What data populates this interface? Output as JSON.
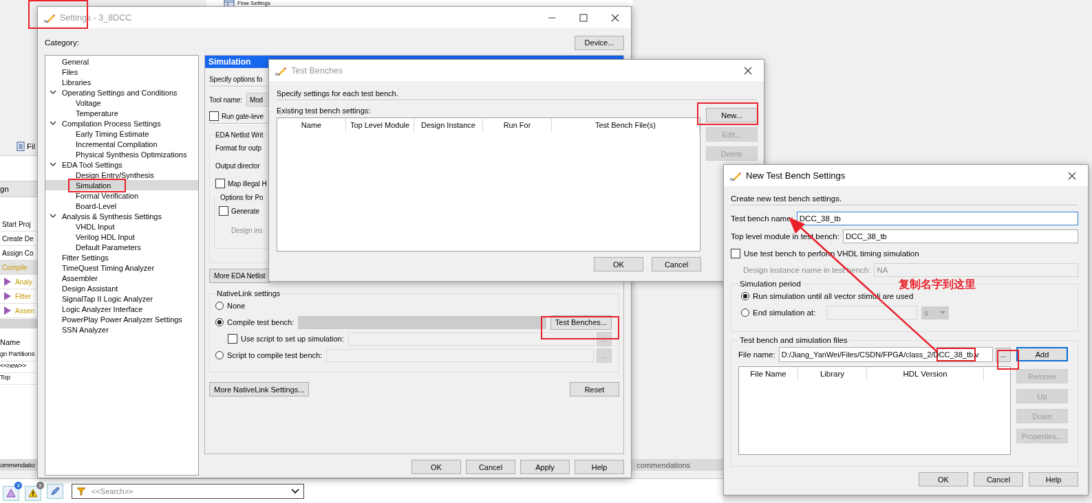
{
  "background_app": {
    "top_strip": "Flow Settings",
    "tab": "Fil",
    "header": "gn",
    "tasks": [
      {
        "label": "Start Proj",
        "kind": "task",
        "selected": false
      },
      {
        "label": "Create De",
        "kind": "task",
        "selected": false
      },
      {
        "label": "Assign Co",
        "kind": "task",
        "selected": false
      },
      {
        "label": "Compile",
        "kind": "task",
        "selected": true
      },
      {
        "label": "Analy",
        "kind": "step",
        "selected": false
      },
      {
        "label": "Fitter",
        "kind": "step",
        "selected": false
      },
      {
        "label": "Assen",
        "kind": "step",
        "selected": false
      }
    ],
    "hierarchy_header": "Name",
    "hierarchy_rows": [
      "gn Partitions",
      "<<new>>",
      "Top"
    ],
    "message_tabs": [
      "ommendatio",
      "commendations"
    ],
    "badges": [
      "3",
      "5"
    ],
    "search": {
      "placeholder": "<<Search>>"
    }
  },
  "settings": {
    "title": "Settings - 3_8DCC",
    "category_label": "Category:",
    "device_button": "Device...",
    "tree": [
      {
        "label": "General",
        "selected": false
      },
      {
        "label": "Files",
        "selected": false
      },
      {
        "label": "Libraries",
        "selected": false
      },
      {
        "label": "Operating Settings and Conditions",
        "selected": false,
        "expanded": true,
        "children": [
          {
            "label": "Voltage",
            "selected": false
          },
          {
            "label": "Temperature",
            "selected": false
          }
        ]
      },
      {
        "label": "Compilation Process Settings",
        "selected": false,
        "expanded": true,
        "children": [
          {
            "label": "Early Timing Estimate",
            "selected": false
          },
          {
            "label": "Incremental Compilation",
            "selected": false
          },
          {
            "label": "Physical Synthesis Optimizations",
            "selected": false
          }
        ]
      },
      {
        "label": "EDA Tool Settings",
        "selected": false,
        "expanded": true,
        "children": [
          {
            "label": "Design Entry/Synthesis",
            "selected": false
          },
          {
            "label": "Simulation",
            "selected": true
          },
          {
            "label": "Formal Verification",
            "selected": false
          },
          {
            "label": "Board-Level",
            "selected": false
          }
        ]
      },
      {
        "label": "Analysis & Synthesis Settings",
        "selected": false,
        "expanded": true,
        "children": [
          {
            "label": "VHDL Input",
            "selected": false
          },
          {
            "label": "Verilog HDL Input",
            "selected": false
          },
          {
            "label": "Default Parameters",
            "selected": false
          }
        ]
      },
      {
        "label": "Fitter Settings",
        "selected": false
      },
      {
        "label": "TimeQuest Timing Analyzer",
        "selected": false
      },
      {
        "label": "Assembler",
        "selected": false
      },
      {
        "label": "Design Assistant",
        "selected": false
      },
      {
        "label": "SignalTap II Logic Analyzer",
        "selected": false
      },
      {
        "label": "Logic Analyzer Interface",
        "selected": false
      },
      {
        "label": "PowerPlay Power Analyzer Settings",
        "selected": false
      },
      {
        "label": "SSN Analyzer",
        "selected": false
      }
    ],
    "page": {
      "header": "Simulation",
      "description": "Specify options fo",
      "tool_name_label": "Tool name:",
      "tool_name_value": "Mod",
      "gate_level": {
        "label": "Run gate-leve",
        "checked": false
      },
      "netlist_group": {
        "title": "EDA Netlist Writ",
        "format_label": "Format for outp",
        "output_label": "Output director",
        "map_illegal": {
          "label": "Map illegal H",
          "checked": false
        },
        "options_group": {
          "title": "Options for Po",
          "generate": {
            "label": "Generate",
            "checked": false
          },
          "design_label": "Design ins"
        }
      },
      "more_netlist_button": "More EDA Netlist",
      "nativelink": {
        "title": "NativeLink settings",
        "options": [
          {
            "label": "None",
            "selected": false
          },
          {
            "label": "Compile test bench:",
            "selected": true
          },
          {
            "label": "Script to compile test bench:",
            "selected": false
          }
        ],
        "test_benches_button": "Test Benches...",
        "use_script": {
          "label": "Use script to set up simulation:",
          "checked": false
        },
        "browse_buttons": [
          "...",
          "..."
        ]
      },
      "more_nativelink_button": "More NativeLink Settings...",
      "reset_button": "Reset"
    },
    "buttons": [
      "OK",
      "Cancel",
      "Apply",
      "Help"
    ]
  },
  "test_benches": {
    "title": "Test Benches",
    "description": "Specify settings for each test bench.",
    "list_label": "Existing test bench settings:",
    "columns": [
      "Name",
      "Top Level Module",
      "Design Instance",
      "Run For",
      "Test Bench File(s)"
    ],
    "side_buttons": [
      {
        "label": "New...",
        "disabled": false
      },
      {
        "label": "Edit...",
        "disabled": true
      },
      {
        "label": "Delete",
        "disabled": true
      }
    ],
    "buttons": [
      "OK",
      "Cancel"
    ]
  },
  "new_test_bench": {
    "title": "New Test Bench Settings",
    "description": "Create new test bench settings.",
    "name_label": "Test bench name:",
    "name_value": "DCC_38_tb",
    "top_label": "Top level module in test bench:",
    "top_value": "DCC_38_tb",
    "vhdl_timing": {
      "label": "Use test bench to perform VHDL timing simulation",
      "checked": false
    },
    "design_instance_label": "Design instance name in test bench:",
    "design_instance_value": "NA",
    "period_group": {
      "title": "Simulation period",
      "options": [
        {
          "label": "Run simulation until all vector stimuli are used",
          "selected": true
        },
        {
          "label": "End simulation at:",
          "selected": false
        }
      ],
      "unit": "s"
    },
    "files_group": {
      "title": "Test bench and simulation files",
      "file_label": "File name:",
      "file_value": "D:/Jiang_YanWei/Files/CSDN/FPGA/class_2/DCC_38_tb.v",
      "browse_button": "...",
      "add_button": "Add",
      "columns": [
        "File Name",
        "Library",
        "HDL Version"
      ],
      "side_buttons": [
        {
          "label": "Remove",
          "disabled": true
        },
        {
          "label": "Up",
          "disabled": true
        },
        {
          "label": "Down",
          "disabled": true
        },
        {
          "label": "Properties...",
          "disabled": true
        }
      ]
    },
    "buttons": [
      "OK",
      "Cancel",
      "Help"
    ]
  },
  "annotation": {
    "note": "复制名字到这里"
  }
}
